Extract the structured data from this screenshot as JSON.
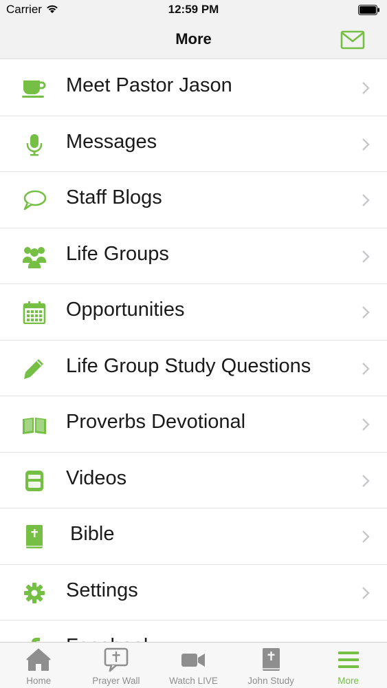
{
  "status_bar": {
    "carrier": "Carrier",
    "time": "12:59 PM"
  },
  "nav": {
    "title": "More",
    "mail_icon": "envelope-icon"
  },
  "colors": {
    "accent": "#74bf44",
    "inactive": "#8e8e8e",
    "chevron": "#c7c7cc"
  },
  "menu": {
    "items": [
      {
        "label": "Meet Pastor Jason",
        "icon": "coffee-cup-icon"
      },
      {
        "label": "Messages",
        "icon": "microphone-icon"
      },
      {
        "label": "Staff Blogs",
        "icon": "speech-bubble-icon"
      },
      {
        "label": "Life Groups",
        "icon": "people-group-icon"
      },
      {
        "label": "Opportunities",
        "icon": "calendar-icon"
      },
      {
        "label": "Life Group Study Questions",
        "icon": "pencil-icon"
      },
      {
        "label": "Proverbs Devotional",
        "icon": "open-book-icon"
      },
      {
        "label": "Videos",
        "icon": "youtube-icon"
      },
      {
        "label": "Bible",
        "icon": "bible-icon"
      },
      {
        "label": "Settings",
        "icon": "gear-icon"
      },
      {
        "label": "Facebook",
        "icon": "facebook-icon"
      }
    ]
  },
  "tabs": [
    {
      "label": "Home",
      "icon": "home-icon",
      "active": false
    },
    {
      "label": "Prayer Wall",
      "icon": "prayer-bubble-icon",
      "active": false
    },
    {
      "label": "Watch LIVE",
      "icon": "video-camera-icon",
      "active": false
    },
    {
      "label": "John Study",
      "icon": "book-cross-icon",
      "active": false
    },
    {
      "label": "More",
      "icon": "hamburger-menu-icon",
      "active": true
    }
  ]
}
